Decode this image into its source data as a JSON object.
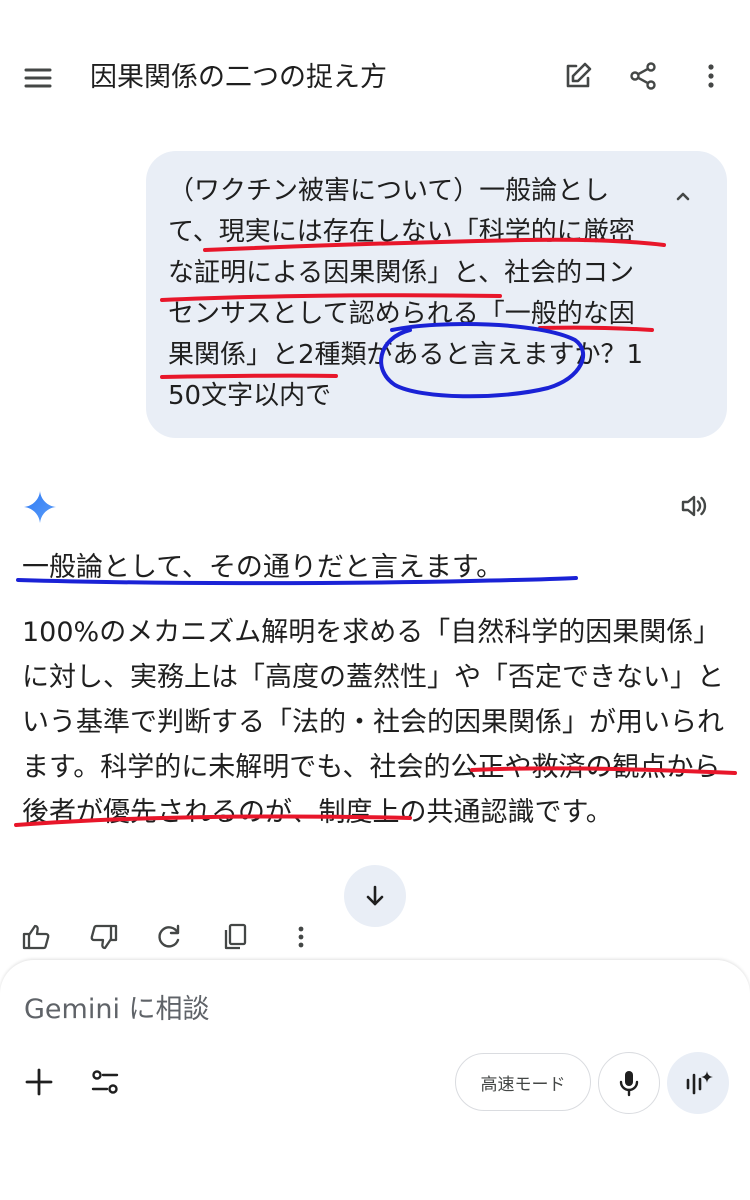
{
  "header": {
    "title": "因果関係の二つの捉え方",
    "icons": [
      "menu-icon",
      "edit-icon",
      "share-icon",
      "more-vert-icon"
    ]
  },
  "user_message": {
    "text": "（ワクチン被害について）一般論として、現実には存在しない「科学的に厳密な証明による因果関係」と、社会的コンセンサスとして認められる「一般的な因果関係」と2種類があると言えますか？150文字以内で"
  },
  "response": {
    "lead": "一般論として、その通りだと言えます。",
    "body": "100%のメカニズム解明を求める「自然科学的因果関係」に対し、実務上は「高度の蓋然性」や「否定できない」という基準で判断する「法的・社会的因果関係」が用いられます。科学的に未解明でも、社会的公正や救済の観点から後者が優先されるのが、制度上の共通認識です。"
  },
  "composer": {
    "placeholder": "Gemini に相談",
    "mode_label": "高速モード"
  },
  "colors": {
    "bubble": "#e9eef6",
    "red_annotation": "#e8162a",
    "blue_annotation": "#1a22d6",
    "gemini_blue": "#4285f4"
  }
}
